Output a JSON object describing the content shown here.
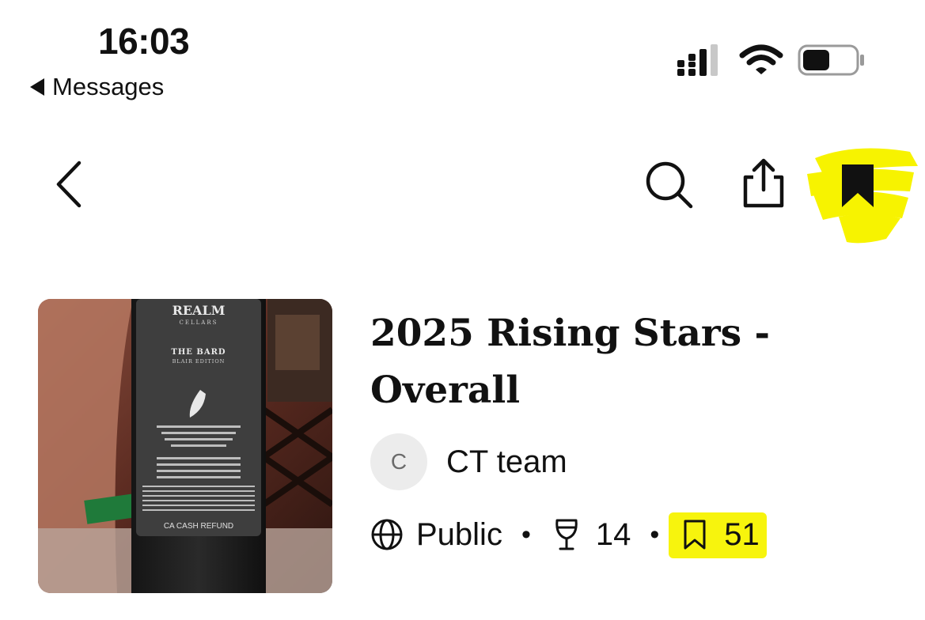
{
  "status_bar": {
    "time": "16:03",
    "back_label": "Messages"
  },
  "nav": {
    "icons": [
      "back-chevron-icon",
      "search-icon",
      "share-icon",
      "bookmark-icon"
    ],
    "highlight_color": "#f7f300"
  },
  "list": {
    "title": "2025 Rising Stars - Overall",
    "author_initial": "C",
    "author_name": "CT team",
    "visibility": "Public",
    "wine_count": "14",
    "bookmark_count": "51"
  },
  "thumbnail": {
    "label_brand": "REALM",
    "label_sub": "CELLARS",
    "label_wine": "THE BARD",
    "label_edition": "BLAIR EDITION",
    "label_refund": "CA CASH REFUND"
  }
}
